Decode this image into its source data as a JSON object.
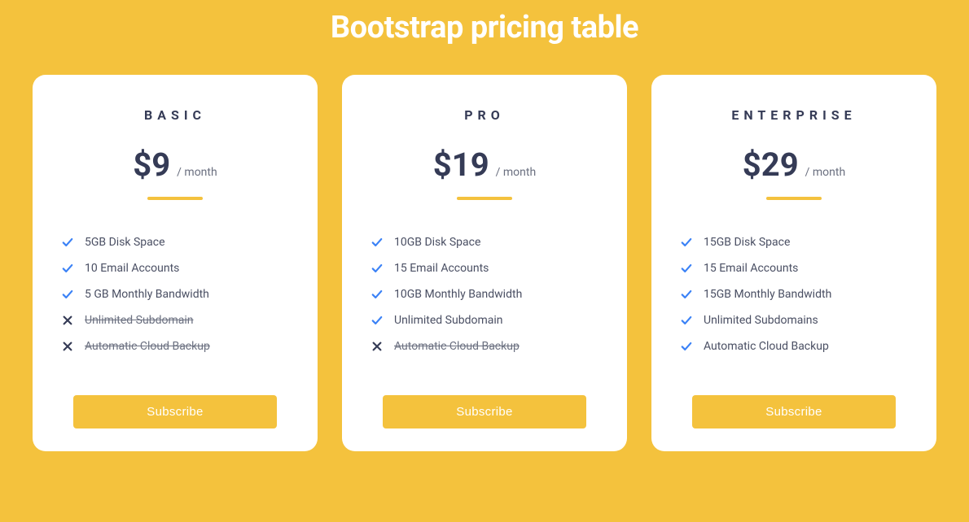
{
  "title": "Bootstrap pricing table",
  "plans": [
    {
      "name": "BASIC",
      "price": "$9",
      "period": "/ month",
      "cta": "Subscribe",
      "features": [
        {
          "text": "5GB Disk Space",
          "included": true
        },
        {
          "text": "10 Email Accounts",
          "included": true
        },
        {
          "text": "5 GB Monthly Bandwidth",
          "included": true
        },
        {
          "text": "Unlimited Subdomain",
          "included": false
        },
        {
          "text": "Automatic Cloud Backup",
          "included": false
        }
      ]
    },
    {
      "name": "PRO",
      "price": "$19",
      "period": "/ month",
      "cta": "Subscribe",
      "features": [
        {
          "text": "10GB Disk Space",
          "included": true
        },
        {
          "text": "15 Email Accounts",
          "included": true
        },
        {
          "text": "10GB Monthly Bandwidth",
          "included": true
        },
        {
          "text": "Unlimited Subdomain",
          "included": true
        },
        {
          "text": "Automatic Cloud Backup",
          "included": false
        }
      ]
    },
    {
      "name": "ENTERPRISE",
      "price": "$29",
      "period": "/ month",
      "cta": "Subscribe",
      "features": [
        {
          "text": "15GB Disk Space",
          "included": true
        },
        {
          "text": "15 Email Accounts",
          "included": true
        },
        {
          "text": "15GB Monthly Bandwidth",
          "included": true
        },
        {
          "text": "Unlimited Subdomains",
          "included": true
        },
        {
          "text": "Automatic Cloud Backup",
          "included": true
        }
      ]
    }
  ]
}
